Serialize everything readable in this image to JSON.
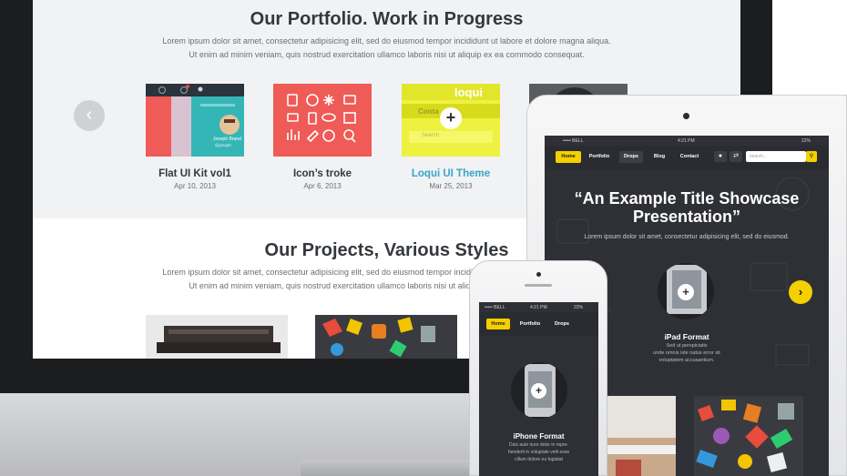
{
  "desktop": {
    "portfolio": {
      "title": "Our Portfolio. Work in Progress",
      "text_line1": "Lorem ipsum dolor sit amet, consectetur adipisicing elit, sed do eiusmod tempor incididunt ut labore et dolore magna aliqua.",
      "text_line2": "Ut enim ad minim veniam, quis nostrud exercitation ullamco laboris nisi ut aliquip ex ea commodo consequat.",
      "prev_icon": "chevron-left-icon",
      "cards": [
        {
          "title": "Flat UI Kit vol1",
          "date": "Apr 10, 2013"
        },
        {
          "title": "Icon’s troke",
          "date": "Apr 6, 2013"
        },
        {
          "title": "Loqui UI Theme",
          "date": "Mar 25, 2013"
        }
      ],
      "loqui_thumb": {
        "brand": "loqui",
        "tab_text": "Conta",
        "search_text": "Search",
        "plus": "+"
      },
      "flat_thumb": {
        "caption_name": "Joseph Brand",
        "caption_sub": "@joseph"
      },
      "accent_colors": {
        "link": "#3aa4c9",
        "coral": "#ef5b56",
        "teal": "#35b6b6",
        "yellow": "#f2ee26"
      }
    },
    "projects": {
      "title": "Our Projects, Various Styles",
      "text_line1": "Lorem ipsum dolor sit amet, consectetur adipisicing elit, sed do eiusmod tempor incididunt ut labore et dolore magna aliqua.",
      "text_line2": "Ut enim ad minim veniam, quis nostrud exercitation ullamco laboris nisi ut aliquip ex ea commodo consequat."
    }
  },
  "ipad": {
    "status": {
      "carrier": "••••• BELL",
      "time": "4:21 PM",
      "battery": "22%"
    },
    "nav": {
      "items": [
        "Home",
        "Portfolio",
        "Drops",
        "Blog",
        "Contact"
      ],
      "search_placeholder": "search..."
    },
    "hero": {
      "title_line1": "“An Example Title Showcase",
      "title_line2": "Presentation”",
      "subtitle": "Lorem ipsum dolor sit amet, consectetur adipisicing elit, sed do eiusmod."
    },
    "feature": {
      "title": "iPad Format",
      "text_line1": "Sed ut perspiciatis",
      "text_line2": "unde omnis iste natus error sit",
      "text_line3": "voluptatem accusantium."
    },
    "accent": "#f5d000"
  },
  "iphone": {
    "status": {
      "carrier": "••••• BELL",
      "time": "4:21 PM",
      "battery": "22%"
    },
    "nav": {
      "items": [
        "Home",
        "Portfolio",
        "Drops"
      ]
    },
    "feature": {
      "title": "iPhone Format",
      "text_line1": "Duis aute irure dolor in repre-",
      "text_line2": "henderit in voluptate velit esse",
      "text_line3": "cillum dolore eu fugiatat"
    }
  }
}
